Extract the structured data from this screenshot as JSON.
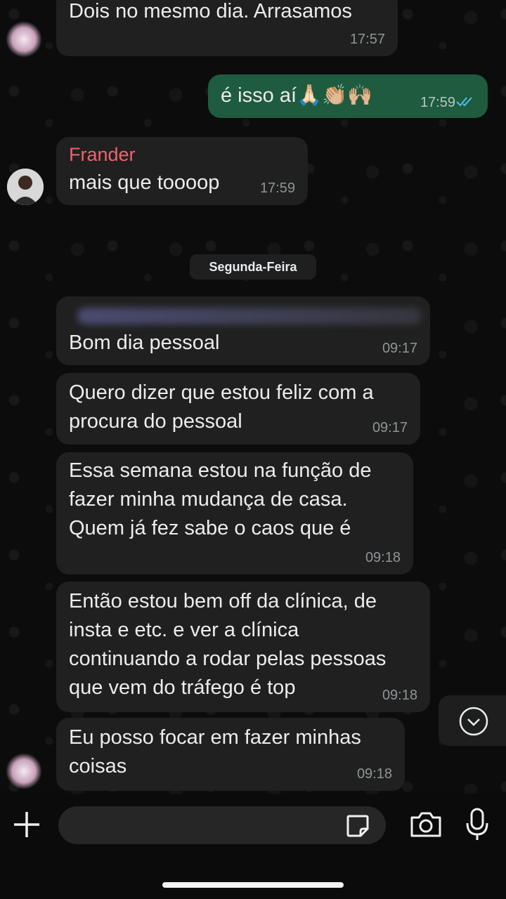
{
  "messages": [
    {
      "text": "Dois no mesmo dia. Arrasamos",
      "time": "17:57"
    },
    {
      "text": "é isso aí🙏🏻👏🏼🙌🏼",
      "time": "17:59"
    },
    {
      "sender": "Frander",
      "text": "mais que toooop",
      "time": "17:59"
    },
    {
      "text": "Bom dia pessoal",
      "time": "09:17"
    },
    {
      "text": "Quero dizer que estou feliz com a\nprocura do pessoal",
      "time": "09:17"
    },
    {
      "text": "Essa semana estou na função de\nfazer minha mudança de casa.\nQuem já fez sabe o caos que é",
      "time": "09:18"
    },
    {
      "text": "Então estou bem off da clínica, de\ninsta e etc. e ver a clínica\ncontinuando a rodar pelas pessoas\nque vem do tráfego é top",
      "time": "09:18"
    },
    {
      "text": "Eu posso focar em fazer minhas\ncoisas",
      "time": "09:18"
    }
  ],
  "date_divider": "Segunda-Feira",
  "colors": {
    "incoming_bubble": "#202020",
    "outgoing_bubble": "#1e5b3f",
    "sender_name": "#f0626d",
    "read_ticks": "#53bdeb"
  },
  "icons": {
    "attach": "plus-icon",
    "sticker": "sticker-icon",
    "camera": "camera-icon",
    "mic": "microphone-icon",
    "scroll": "chevron-down-icon",
    "status": "double-check-icon"
  }
}
